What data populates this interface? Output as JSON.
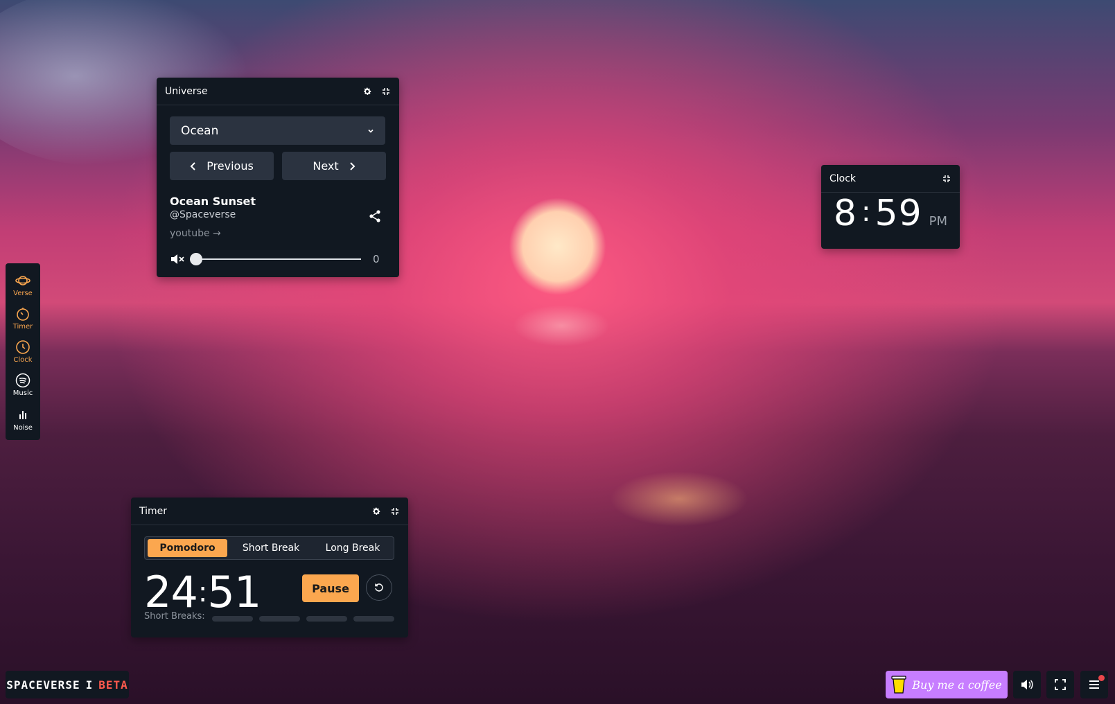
{
  "colors": {
    "accent": "#fba74f",
    "panel": "#111821",
    "coffee": "#c77dff",
    "beta": "#ff5a4e"
  },
  "universe": {
    "title": "Universe",
    "selected": "Ocean",
    "prev_label": "Previous",
    "next_label": "Next",
    "track_title": "Ocean Sunset",
    "track_author": "@Spaceverse",
    "link": "youtube →",
    "volume": "0"
  },
  "clock": {
    "title": "Clock",
    "hour": "8",
    "minute": "59",
    "ampm": "PM"
  },
  "sidebar": {
    "items": [
      {
        "label": "Verse",
        "icon": "planet-icon"
      },
      {
        "label": "Timer",
        "icon": "timer-icon"
      },
      {
        "label": "Clock",
        "icon": "clock-icon"
      },
      {
        "label": "Music",
        "icon": "spotify-icon"
      },
      {
        "label": "Noise",
        "icon": "bars-icon"
      }
    ]
  },
  "timer": {
    "title": "Timer",
    "tabs": [
      "Pomodoro",
      "Short Break",
      "Long Break"
    ],
    "minutes": "24",
    "seconds": "51",
    "pause_label": "Pause",
    "breaks_label": "Short Breaks:",
    "breaks_completed": 0
  },
  "brand": {
    "name": "SPACEVERSE",
    "sep": "I",
    "tag": "BETA"
  },
  "footer": {
    "coffee_label": "Buy me a coffee"
  }
}
